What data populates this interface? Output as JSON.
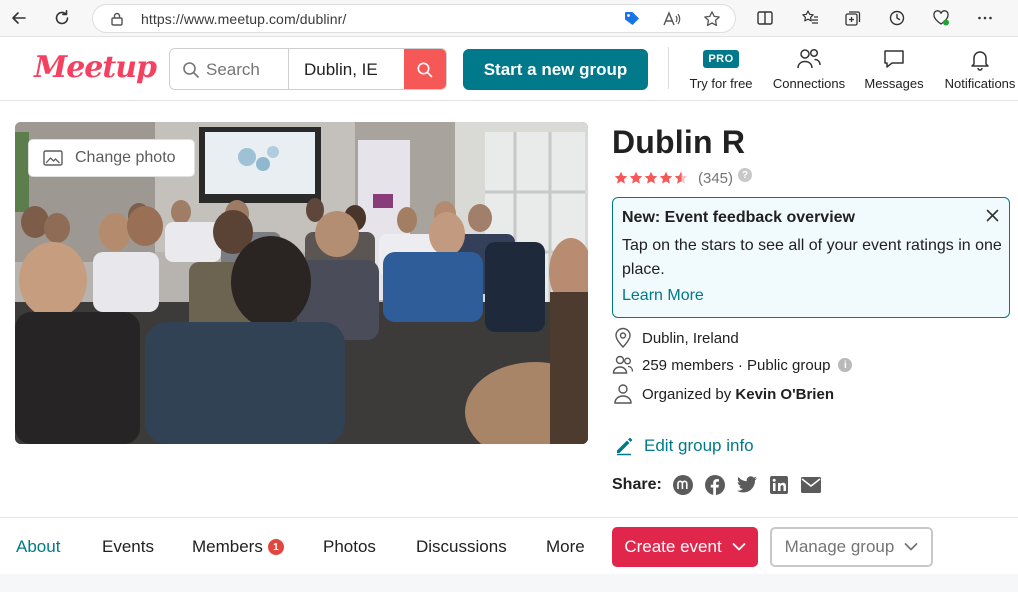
{
  "browser": {
    "url": "https://www.meetup.com/dublinr/"
  },
  "header": {
    "logo_text": "Meetup",
    "search_placeholder": "Search",
    "location": "Dublin, IE",
    "start_group_label": "Start a new group",
    "nav": [
      {
        "label": "Try for free",
        "badge": "PRO"
      },
      {
        "label": "Connections"
      },
      {
        "label": "Messages"
      },
      {
        "label": "Notifications"
      }
    ]
  },
  "photo": {
    "change_label": "Change photo"
  },
  "group": {
    "title": "Dublin R",
    "rating_value": 4.5,
    "rating_count": "(345)",
    "help_glyph": "?",
    "location": "Dublin, Ireland",
    "members_text": "259 members · Public group",
    "info_glyph": "i",
    "organized_prefix": "Organized by ",
    "organizer": "Kevin O'Brien",
    "edit_label": "Edit group info",
    "share_label": "Share:"
  },
  "feedback": {
    "title": "New: Event feedback overview",
    "body": "Tap on the stars to see all of your event ratings in one place.",
    "link": "Learn More"
  },
  "tabs": {
    "items": [
      {
        "label": "About",
        "active": true
      },
      {
        "label": "Events"
      },
      {
        "label": "Members",
        "badge": "1"
      },
      {
        "label": "Photos"
      },
      {
        "label": "Discussions"
      },
      {
        "label": "More"
      }
    ],
    "create_label": "Create event",
    "manage_label": "Manage group"
  },
  "colors": {
    "brand": "#f64060",
    "teal": "#00798a",
    "create": "#e0264b",
    "star": "#f65858"
  }
}
